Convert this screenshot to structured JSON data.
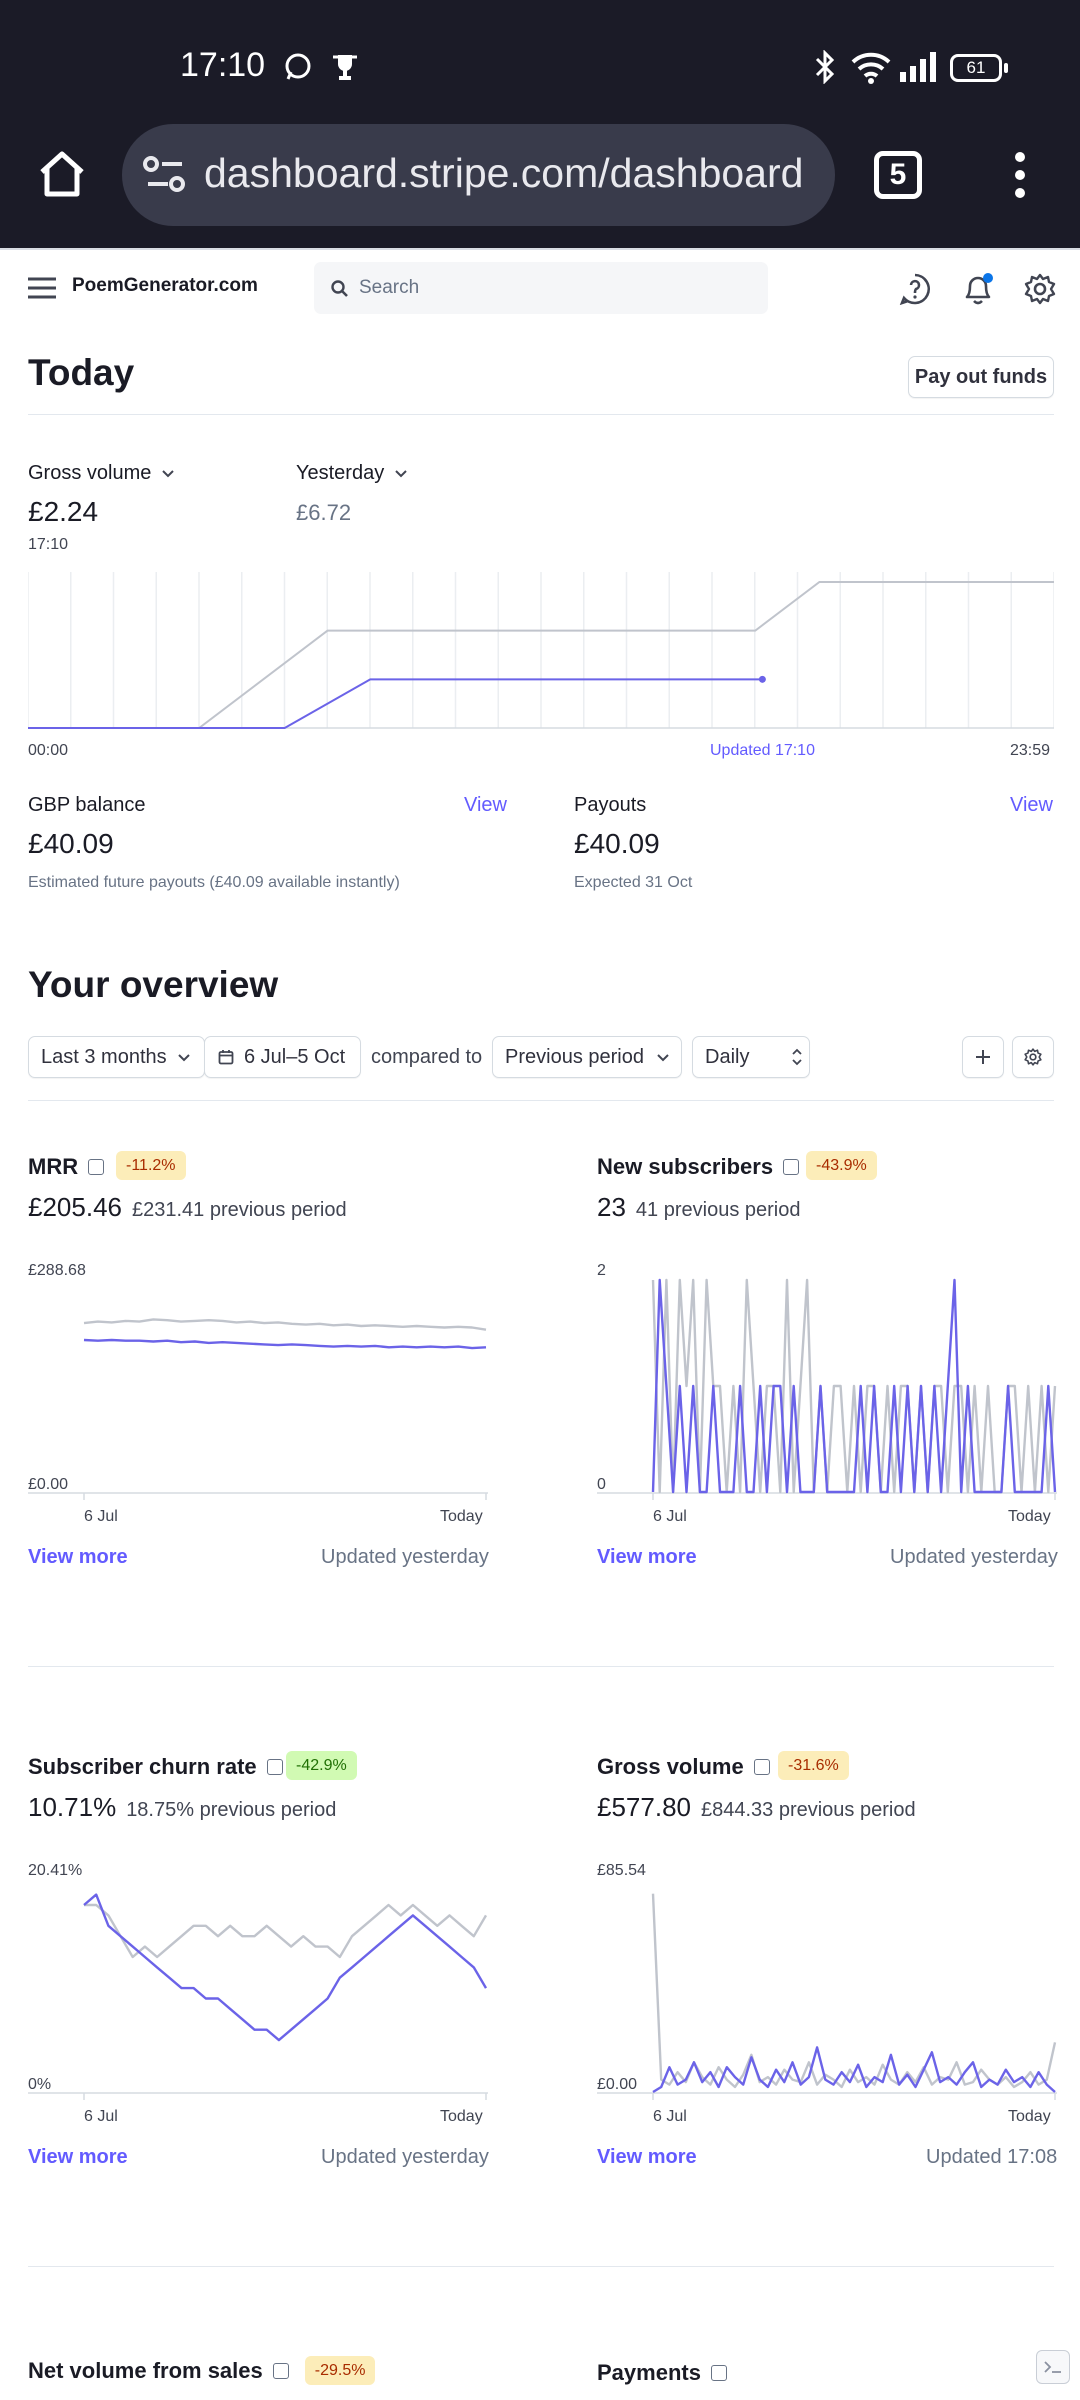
{
  "status_bar": {
    "time": "17:10",
    "battery": "61"
  },
  "browser": {
    "url": "dashboard.stripe.com/dashboard",
    "tab_count": "5"
  },
  "header": {
    "account_name": "PoemGenerator.com",
    "search_placeholder": "Search"
  },
  "today": {
    "title": "Today",
    "payout_button": "Pay out funds",
    "gross_volume_label": "Gross volume",
    "gross_volume_value": "£2.24",
    "gross_volume_time": "17:10",
    "yesterday_label": "Yesterday",
    "yesterday_value": "£6.72",
    "axis_start": "00:00",
    "axis_updated": "Updated 17:10",
    "axis_end": "23:59",
    "balance_label": "GBP balance",
    "balance_view": "View",
    "balance_value": "£40.09",
    "balance_note": "Estimated future payouts (£40.09 available instantly)",
    "payouts_label": "Payouts",
    "payouts_view": "View",
    "payouts_value": "£40.09",
    "payouts_note": "Expected 31 Oct"
  },
  "overview": {
    "title": "Your overview",
    "range": "Last 3 months",
    "dates": "6 Jul–5 Oct",
    "compared_to": "compared to",
    "comparison": "Previous period",
    "interval": "Daily"
  },
  "colors": {
    "accent": "#635bff",
    "current_series": "#6b63e8",
    "previous_series": "#c0c4cc"
  },
  "cards": [
    {
      "title": "MRR",
      "badge": "-11.2%",
      "badge_type": "neg",
      "value": "£205.46",
      "previous": "£231.41 previous period",
      "y_top": "£288.68",
      "y_bottom": "£0.00",
      "x_start": "6 Jul",
      "x_end": "Today",
      "view_more": "View more",
      "updated": "Updated yesterday"
    },
    {
      "title": "New subscribers",
      "badge": "-43.9%",
      "badge_type": "neg",
      "value": "23",
      "previous": "41 previous period",
      "y_top": "2",
      "y_bottom": "0",
      "x_start": "6 Jul",
      "x_end": "Today",
      "view_more": "View more",
      "updated": "Updated yesterday"
    },
    {
      "title": "Subscriber churn rate",
      "badge": "-42.9%",
      "badge_type": "pos",
      "value": "10.71%",
      "previous": "18.75% previous period",
      "y_top": "20.41%",
      "y_bottom": "0%",
      "x_start": "6 Jul",
      "x_end": "Today",
      "view_more": "View more",
      "updated": "Updated yesterday"
    },
    {
      "title": "Gross volume",
      "badge": "-31.6%",
      "badge_type": "neg",
      "value": "£577.80",
      "previous": "£844.33 previous period",
      "y_top": "£85.54",
      "y_bottom": "£0.00",
      "x_start": "6 Jul",
      "x_end": "Today",
      "view_more": "View more",
      "updated": "Updated 17:08"
    },
    {
      "title": "Net volume from sales",
      "badge": "-29.5%",
      "badge_type": "neg"
    },
    {
      "title": "Payments"
    }
  ],
  "chart_data": [
    {
      "type": "line",
      "title": "Gross volume",
      "x_range": [
        "00:00",
        "23:59"
      ],
      "series": [
        {
          "name": "Gross volume",
          "x": [
            "00:00",
            "06:00",
            "08:00",
            "17:10"
          ],
          "values": [
            0,
            0,
            2.24,
            2.24
          ]
        },
        {
          "name": "Yesterday",
          "x": [
            "00:00",
            "04:00",
            "07:00",
            "17:00",
            "18:30",
            "23:59"
          ],
          "values": [
            0,
            0,
            4.48,
            4.48,
            6.72,
            6.72
          ]
        }
      ]
    },
    {
      "type": "line",
      "title": "MRR",
      "ylim": [
        0,
        288.68
      ],
      "series": [
        {
          "values": [
            207,
            206,
            207,
            206,
            206,
            205,
            206,
            204,
            205,
            203,
            204,
            203,
            202,
            201,
            200,
            201,
            200,
            199,
            198,
            199,
            198,
            199,
            197,
            198,
            197,
            198,
            197,
            198,
            196,
            197
          ]
        },
        {
          "values": [
            230,
            232,
            231,
            233,
            232,
            235,
            234,
            232,
            233,
            234,
            233,
            231,
            232,
            230,
            231,
            229,
            228,
            229,
            227,
            228,
            226,
            227,
            226,
            225,
            226,
            225,
            224,
            225,
            224,
            221
          ]
        }
      ]
    },
    {
      "type": "line",
      "title": "New subscribers",
      "ylim": [
        0,
        2
      ],
      "series": [
        {
          "values": [
            0,
            2,
            1,
            0,
            1,
            0,
            1,
            0,
            0,
            1,
            0,
            0,
            0,
            1,
            0,
            0,
            1,
            0,
            1,
            1,
            0,
            1,
            0,
            0,
            0,
            1,
            0,
            0,
            0,
            0,
            0,
            1,
            0,
            1,
            0,
            0,
            1,
            0,
            1,
            0,
            1,
            0,
            1,
            0,
            1,
            2,
            0,
            1,
            0,
            0,
            0,
            0,
            0,
            1,
            0,
            0,
            0,
            0,
            0,
            1,
            0
          ]
        },
        {
          "values": [
            2,
            0,
            2,
            0,
            2,
            1,
            2,
            0,
            2,
            1,
            1,
            0,
            1,
            0,
            2,
            1,
            0,
            1,
            1,
            0,
            2,
            0,
            1,
            2,
            0,
            1,
            0,
            1,
            1,
            0,
            1,
            0,
            1,
            1,
            0,
            1,
            0,
            1,
            1,
            0,
            1,
            0,
            1,
            1,
            0,
            1,
            1,
            0,
            1,
            0,
            1,
            0,
            0,
            1,
            1,
            0,
            1,
            0,
            1,
            0,
            1
          ]
        }
      ]
    },
    {
      "type": "line",
      "title": "Subscriber churn rate",
      "ylim": [
        0,
        20.41
      ],
      "series": [
        {
          "values": [
            18,
            19,
            16,
            15,
            14,
            13,
            12,
            11,
            10,
            10,
            9,
            9,
            8,
            7,
            6,
            6,
            5,
            6,
            7,
            8,
            9,
            11,
            12,
            13,
            14,
            15,
            16,
            17,
            16,
            15,
            14,
            13,
            12,
            10
          ]
        },
        {
          "values": [
            18,
            18,
            17,
            15,
            13,
            14,
            13,
            14,
            15,
            16,
            16,
            15,
            16,
            15,
            15,
            16,
            15,
            14,
            15,
            14,
            14,
            13,
            15,
            16,
            17,
            18,
            17,
            18,
            17,
            16,
            17,
            16,
            15,
            17
          ]
        }
      ]
    },
    {
      "type": "line",
      "title": "Gross volume",
      "ylim": [
        0,
        85.54
      ],
      "series": [
        {
          "values": [
            0,
            2,
            10,
            3,
            5,
            12,
            4,
            8,
            2,
            10,
            6,
            3,
            14,
            5,
            2,
            9,
            4,
            12,
            3,
            6,
            18,
            5,
            3,
            8,
            4,
            11,
            2,
            6,
            4,
            15,
            3,
            7,
            2,
            9,
            16,
            4,
            6,
            3,
            8,
            12,
            2,
            5,
            3,
            9,
            4,
            6,
            2,
            8,
            3,
            0
          ]
        },
        {
          "values": [
            80,
            5,
            3,
            8,
            4,
            12,
            6,
            3,
            10,
            5,
            2,
            7,
            15,
            4,
            6,
            3,
            9,
            5,
            4,
            12,
            3,
            7,
            5,
            2,
            9,
            4,
            6,
            3,
            11,
            5,
            3,
            8,
            4,
            10,
            3,
            6,
            5,
            12,
            3,
            4,
            9,
            5,
            3,
            6,
            2,
            4,
            8,
            3,
            5,
            20
          ]
        }
      ]
    }
  ]
}
